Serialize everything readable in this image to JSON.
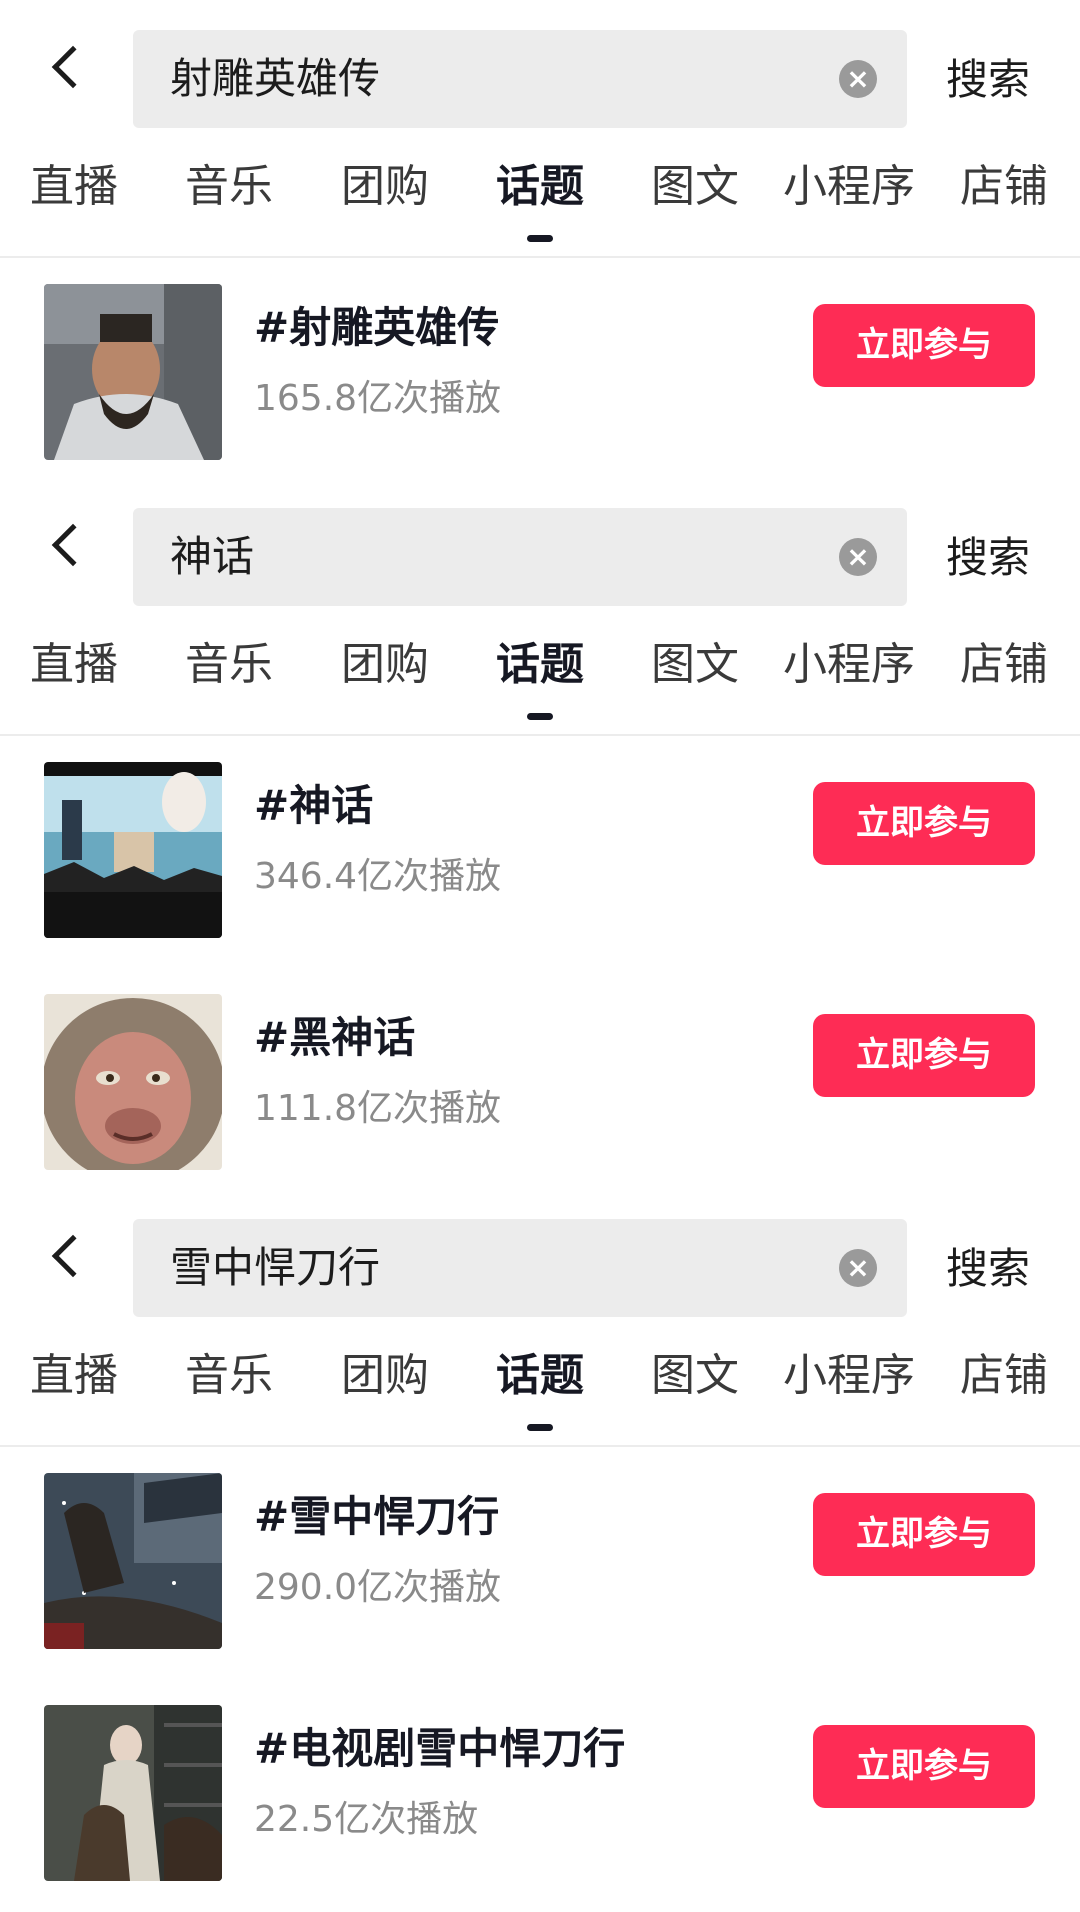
{
  "screens": [
    {
      "query": "射雕英雄传",
      "search_label": "搜索",
      "tabs": [
        "直播",
        "音乐",
        "团购",
        "话题",
        "图文",
        "小程序",
        "店铺"
      ],
      "results": [
        {
          "title": "#射雕英雄传",
          "plays": "165.8亿次播放",
          "action": "立即参与"
        }
      ]
    },
    {
      "query": "神话",
      "search_label": "搜索",
      "tabs": [
        "直播",
        "音乐",
        "团购",
        "话题",
        "图文",
        "小程序",
        "店铺"
      ],
      "results": [
        {
          "title": "#神话",
          "plays": "346.4亿次播放",
          "action": "立即参与"
        },
        {
          "title": "#黑神话",
          "plays": "111.8亿次播放",
          "action": "立即参与"
        }
      ]
    },
    {
      "query": "雪中悍刀行",
      "search_label": "搜索",
      "tabs": [
        "直播",
        "音乐",
        "团购",
        "话题",
        "图文",
        "小程序",
        "店铺"
      ],
      "results": [
        {
          "title": "#雪中悍刀行",
          "plays": "290.0亿次播放",
          "action": "立即参与"
        },
        {
          "title": "#电视剧雪中悍刀行",
          "plays": "22.5亿次播放",
          "action": "立即参与"
        }
      ]
    }
  ],
  "active_tab": "话题",
  "colors": {
    "accent": "#fe2c55",
    "input_bg": "#ececec",
    "muted": "#8a8a8a"
  },
  "icons": {
    "back": "chevron-left-icon",
    "clear": "clear-circle-icon"
  }
}
